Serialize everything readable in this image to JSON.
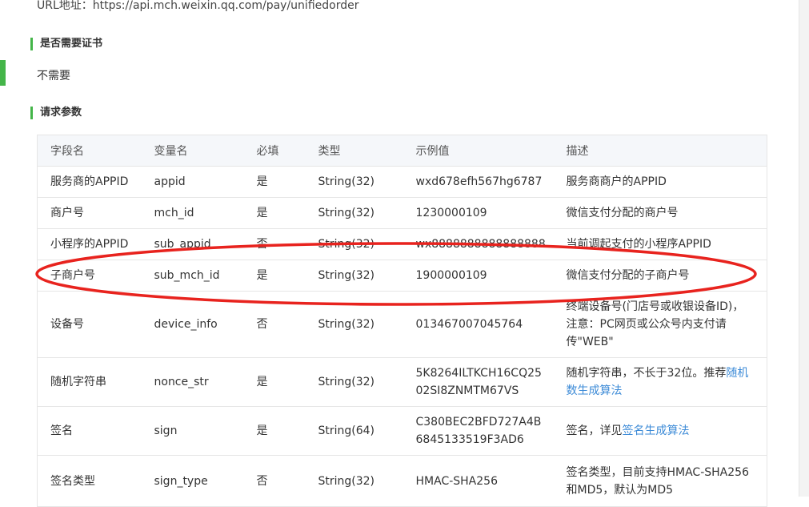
{
  "url_line": "URL地址：https://api.mch.weixin.qq.com/pay/unifiedorder",
  "cert_section": {
    "title": "是否需要证书",
    "value": "不需要"
  },
  "params_section": {
    "title": "请求参数"
  },
  "table": {
    "headers": [
      "字段名",
      "变量名",
      "必填",
      "类型",
      "示例值",
      "描述"
    ],
    "rows": [
      {
        "field": "服务商的APPID",
        "var": "appid",
        "required": "是",
        "type": "String(32)",
        "example": "wxd678efh567hg6787",
        "desc": "服务商商户的APPID"
      },
      {
        "field": "商户号",
        "var": "mch_id",
        "required": "是",
        "type": "String(32)",
        "example": "1230000109",
        "desc": "微信支付分配的商户号"
      },
      {
        "field": "小程序的APPID",
        "var": "sub_appid",
        "required": "否",
        "type": "String(32)",
        "example": "wx8888888888888888",
        "desc": "当前调起支付的小程序APPID"
      },
      {
        "field": "子商户号",
        "var": "sub_mch_id",
        "required": "是",
        "type": "String(32)",
        "example": "1900000109",
        "desc": "微信支付分配的子商户号"
      },
      {
        "field": "设备号",
        "var": "device_info",
        "required": "否",
        "type": "String(32)",
        "example": "013467007045764",
        "desc": "终端设备号(门店号或收银设备ID)，注意：PC网页或公众号内支付请传\"WEB\""
      },
      {
        "field": "随机字符串",
        "var": "nonce_str",
        "required": "是",
        "type": "String(32)",
        "example": "5K8264ILTKCH16CQ2502SI8ZNMTM67VS",
        "desc": "随机字符串，不长于32位。推荐",
        "desc_link": "随机数生成算法"
      },
      {
        "field": "签名",
        "var": "sign",
        "required": "是",
        "type": "String(64)",
        "example": "C380BEC2BFD727A4B6845133519F3AD6",
        "desc": "签名，详见",
        "desc_link": "签名生成算法"
      },
      {
        "field": "签名类型",
        "var": "sign_type",
        "required": "否",
        "type": "String(32)",
        "example": "HMAC-SHA256",
        "desc": "签名类型，目前支持HMAC-SHA256和MD5，默认为MD5"
      }
    ]
  },
  "colors": {
    "accent_green": "#44b549",
    "link_blue": "#3d8bd7",
    "highlight_red": "#e8231e"
  }
}
